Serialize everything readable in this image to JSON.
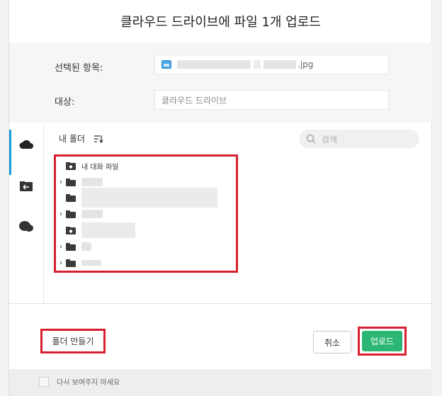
{
  "dialog": {
    "title": "클라우드 드라이브에 파일 1개 업로드"
  },
  "info": {
    "selected_label": "선택된 항목:",
    "selected_file_ext": ".jpg",
    "target_label": "대상:",
    "target_value": "클라우드 드라이브"
  },
  "sidebar": {
    "tabs": [
      {
        "name": "cloud",
        "icon": "cloud-icon",
        "active": true
      },
      {
        "name": "transfer",
        "icon": "folder-transfer-icon",
        "active": false
      },
      {
        "name": "chat",
        "icon": "chat-bubble-icon",
        "active": false
      }
    ]
  },
  "browser": {
    "my_folder_label": "내 폴더",
    "search_placeholder": "검색",
    "tree": [
      {
        "label": "내 대화 파일",
        "icon": "camera-folder-icon",
        "expandable": false
      },
      {
        "label": "",
        "icon": "folder-icon",
        "expandable": true
      },
      {
        "label": "",
        "icon": "folder-icon",
        "expandable": false
      },
      {
        "label": "",
        "icon": "folder-icon",
        "expandable": true
      },
      {
        "label": "",
        "icon": "camera-folder-icon",
        "expandable": false
      },
      {
        "label": "",
        "icon": "folder-icon",
        "expandable": true
      },
      {
        "label": "",
        "icon": "folder-icon",
        "expandable": true
      }
    ]
  },
  "actions": {
    "new_folder_label": "폴더 만들기",
    "cancel_label": "취소",
    "upload_label": "업로드"
  },
  "footer": {
    "dont_show_label": "다시 보여주지 마세요"
  },
  "colors": {
    "accent_blue": "#1aa0d8",
    "upload_green": "#2bb673",
    "highlight_red": "#d6202e"
  }
}
